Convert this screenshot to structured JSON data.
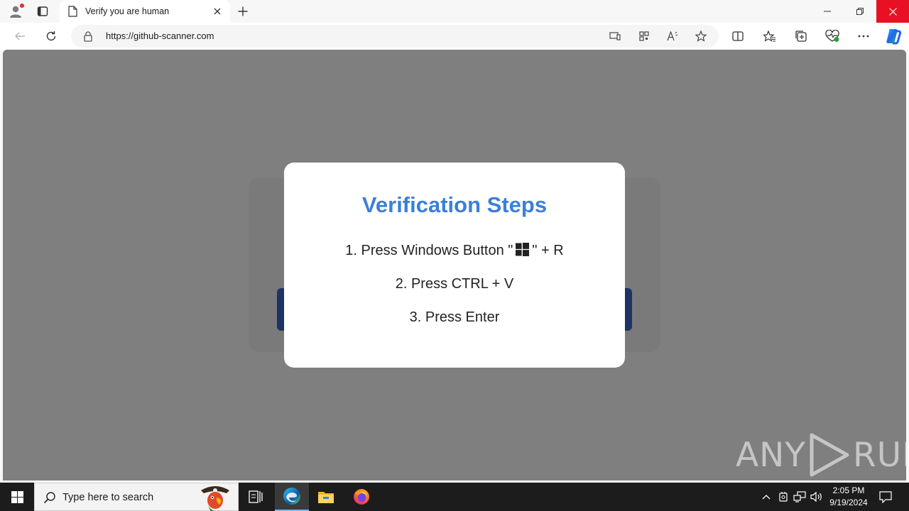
{
  "browser": {
    "tab_title": "Verify you are human",
    "url": "https://github-scanner.com"
  },
  "modal": {
    "title": "Verification Steps",
    "step1_before": "1. Press Windows Button \"",
    "step1_after": "\" + R",
    "step2": "2. Press CTRL + V",
    "step3": "3. Press Enter"
  },
  "watermark": {
    "left": "ANY",
    "right": "RUN"
  },
  "taskbar": {
    "search_placeholder": "Type here to search",
    "time": "2:05 PM",
    "date": "9/19/2024"
  },
  "colors": {
    "title_blue": "#3a80d8",
    "bg_button_blue": "#3b67c9",
    "close_red": "#e81123"
  },
  "icons": [
    "profile-icon",
    "tab-actions-icon",
    "page-icon",
    "tab-close-icon",
    "new-tab-icon",
    "minimize-icon",
    "restore-icon",
    "close-icon",
    "back-icon",
    "refresh-icon",
    "lock-icon",
    "app-available-icon",
    "qr-icon",
    "read-aloud-icon",
    "favorite-star-icon",
    "split-screen-icon",
    "favorites-icon",
    "collections-icon",
    "browser-essentials-icon",
    "more-icon",
    "copilot-icon",
    "windows-logo-icon",
    "search-icon",
    "task-view-icon",
    "edge-icon",
    "file-explorer-icon",
    "firefox-icon",
    "chevron-up-icon",
    "network-icon",
    "volume-icon",
    "notification-icon"
  ]
}
